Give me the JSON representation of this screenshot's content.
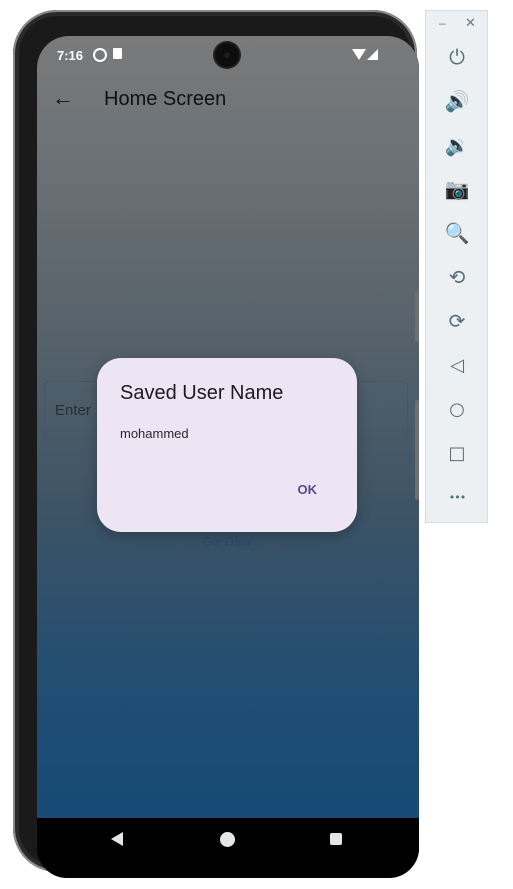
{
  "status_bar": {
    "time": "7:16",
    "icons": [
      "notification-icon",
      "sd-card-icon",
      "camera-cutout",
      "wifi-icon",
      "signal-icon"
    ]
  },
  "app_bar": {
    "title": "Home Screen",
    "back_icon": "arrow-back-icon"
  },
  "form": {
    "input_placeholder": "Enter",
    "get_data_label": "Get Data"
  },
  "dialog": {
    "title": "Saved User Name",
    "content": "mohammed",
    "ok_label": "OK"
  },
  "system_nav": {
    "buttons": [
      "nav-back",
      "nav-home",
      "nav-recents"
    ]
  },
  "emulator_panel": {
    "window_controls": {
      "minimize": "–",
      "close": "✕"
    },
    "tools": [
      {
        "name": "power-icon",
        "glyph": "⏻"
      },
      {
        "name": "volume-up-icon",
        "glyph": "🔊"
      },
      {
        "name": "volume-down-icon",
        "glyph": "🔉"
      },
      {
        "name": "camera-icon",
        "glyph": "📷"
      },
      {
        "name": "zoom-icon",
        "glyph": "🔍"
      },
      {
        "name": "rotate-left-icon",
        "glyph": "⟲"
      },
      {
        "name": "rotate-right-icon",
        "glyph": "⟳"
      },
      {
        "name": "back-icon",
        "glyph": "◁"
      },
      {
        "name": "home-icon",
        "glyph": "○"
      },
      {
        "name": "overview-icon",
        "glyph": "□"
      },
      {
        "name": "more-icon",
        "glyph": "•••"
      }
    ]
  },
  "colors": {
    "dialog_bg": "#ede5f3",
    "dialog_ok": "#5a4a8c",
    "gradient_top": "#7a7a7a",
    "gradient_bottom": "#174a77",
    "panel_icon": "#546e7a"
  }
}
